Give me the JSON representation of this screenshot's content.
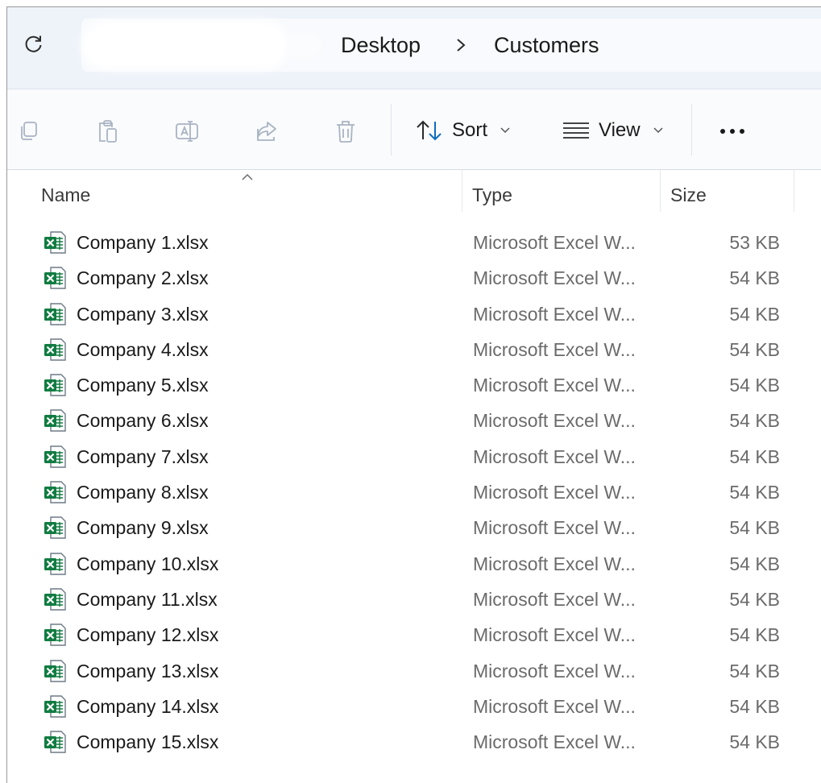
{
  "address": {
    "refresh_icon": "refresh-icon",
    "breadcrumbs": [
      "Desktop",
      "Customers"
    ],
    "separator_icon": "chevron-right-icon"
  },
  "toolbar": {
    "icons": [
      "copy-icon",
      "paste-icon",
      "rename-icon",
      "share-icon",
      "delete-icon"
    ],
    "sort_label": "Sort",
    "view_label": "View",
    "more_icon": "more-options-icon"
  },
  "columns": {
    "name": "Name",
    "type": "Type",
    "size": "Size",
    "sorted_by": "Name",
    "sort_direction": "ascending"
  },
  "files": [
    {
      "name": "Company 1.xlsx",
      "type": "Microsoft Excel W...",
      "size": "53 KB"
    },
    {
      "name": "Company 2.xlsx",
      "type": "Microsoft Excel W...",
      "size": "54 KB"
    },
    {
      "name": "Company 3.xlsx",
      "type": "Microsoft Excel W...",
      "size": "54 KB"
    },
    {
      "name": "Company 4.xlsx",
      "type": "Microsoft Excel W...",
      "size": "54 KB"
    },
    {
      "name": "Company 5.xlsx",
      "type": "Microsoft Excel W...",
      "size": "54 KB"
    },
    {
      "name": "Company 6.xlsx",
      "type": "Microsoft Excel W...",
      "size": "54 KB"
    },
    {
      "name": "Company 7.xlsx",
      "type": "Microsoft Excel W...",
      "size": "54 KB"
    },
    {
      "name": "Company 8.xlsx",
      "type": "Microsoft Excel W...",
      "size": "54 KB"
    },
    {
      "name": "Company 9.xlsx",
      "type": "Microsoft Excel W...",
      "size": "54 KB"
    },
    {
      "name": "Company 10.xlsx",
      "type": "Microsoft Excel W...",
      "size": "54 KB"
    },
    {
      "name": "Company 11.xlsx",
      "type": "Microsoft Excel W...",
      "size": "54 KB"
    },
    {
      "name": "Company 12.xlsx",
      "type": "Microsoft Excel W...",
      "size": "54 KB"
    },
    {
      "name": "Company 13.xlsx",
      "type": "Microsoft Excel W...",
      "size": "54 KB"
    },
    {
      "name": "Company 14.xlsx",
      "type": "Microsoft Excel W...",
      "size": "54 KB"
    },
    {
      "name": "Company 15.xlsx",
      "type": "Microsoft Excel W...",
      "size": "54 KB"
    }
  ],
  "colors": {
    "excel_green": "#107c41",
    "accent_blue": "#0f6cbd",
    "address_bg": "#eef3fa"
  }
}
